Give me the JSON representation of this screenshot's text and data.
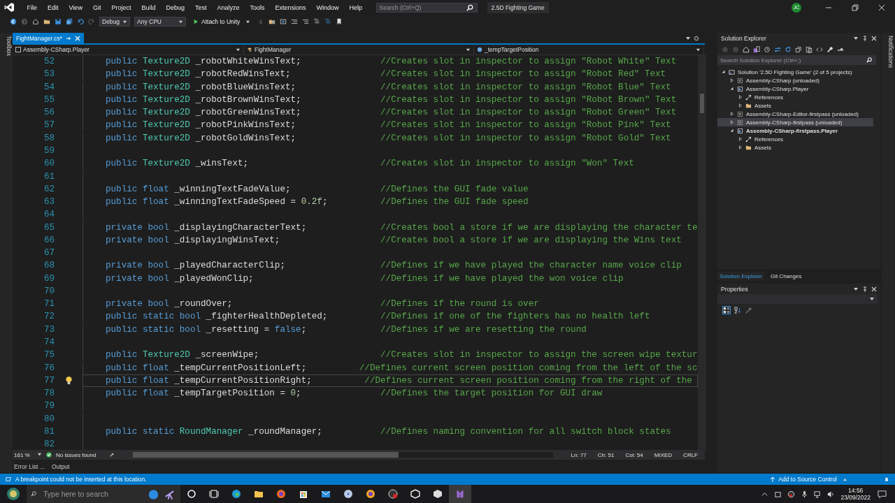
{
  "menu": [
    "File",
    "Edit",
    "View",
    "Git",
    "Project",
    "Build",
    "Debug",
    "Test",
    "Analyze",
    "Tools",
    "Extensions",
    "Window",
    "Help"
  ],
  "search": {
    "placeholder": "Search (Ctrl+Q)"
  },
  "solution_name": "2.5D Fighting Game",
  "avatar": "JC",
  "toolbar": {
    "configuration": "Debug",
    "platform": "Any CPU",
    "run_button": "Attach to Unity"
  },
  "side_strips": {
    "left": "Toolbox",
    "right": "Notifications"
  },
  "document_tabs": [
    {
      "label": "FightManager.cs*",
      "selected": true
    }
  ],
  "navigation_bar": [
    "Assembly-CSharp.Player",
    "FightManager",
    "_tempTargetPosition"
  ],
  "editor": {
    "lines": [
      {
        "number": "52",
        "current": false,
        "tokens": [
          {
            "kind": "keyword",
            "text": "public "
          },
          {
            "kind": "type",
            "text": "Texture2D"
          },
          {
            "kind": "plain",
            "text": " _robotWhiteWinsText;               "
          },
          {
            "kind": "comment",
            "text": "//Creates slot in inspector to assign \"Robot White\" Text"
          }
        ]
      },
      {
        "number": "53",
        "current": false,
        "tokens": [
          {
            "kind": "keyword",
            "text": "public "
          },
          {
            "kind": "type",
            "text": "Texture2D"
          },
          {
            "kind": "plain",
            "text": " _robotRedWinsText;                 "
          },
          {
            "kind": "comment",
            "text": "//Creates slot in inspector to assign \"Robot Red\" Text"
          }
        ]
      },
      {
        "number": "54",
        "current": false,
        "tokens": [
          {
            "kind": "keyword",
            "text": "public "
          },
          {
            "kind": "type",
            "text": "Texture2D"
          },
          {
            "kind": "plain",
            "text": " _robotBlueWinsText;                "
          },
          {
            "kind": "comment",
            "text": "//Creates slot in inspector to assign \"Robot Blue\" Text"
          }
        ]
      },
      {
        "number": "55",
        "current": false,
        "tokens": [
          {
            "kind": "keyword",
            "text": "public "
          },
          {
            "kind": "type",
            "text": "Texture2D"
          },
          {
            "kind": "plain",
            "text": " _robotBrownWinsText;               "
          },
          {
            "kind": "comment",
            "text": "//Creates slot in inspector to assign \"Robot Brown\" Text"
          }
        ]
      },
      {
        "number": "56",
        "current": false,
        "tokens": [
          {
            "kind": "keyword",
            "text": "public "
          },
          {
            "kind": "type",
            "text": "Texture2D"
          },
          {
            "kind": "plain",
            "text": " _robotGreenWinsText;               "
          },
          {
            "kind": "comment",
            "text": "//Creates slot in inspector to assign \"Robot Green\" Text"
          }
        ]
      },
      {
        "number": "57",
        "current": false,
        "tokens": [
          {
            "kind": "keyword",
            "text": "public "
          },
          {
            "kind": "type",
            "text": "Texture2D"
          },
          {
            "kind": "plain",
            "text": " _robotPinkWinsText;                "
          },
          {
            "kind": "comment",
            "text": "//Creates slot in inspector to assign \"Robot Pink\" Text"
          }
        ]
      },
      {
        "number": "58",
        "current": false,
        "tokens": [
          {
            "kind": "keyword",
            "text": "public "
          },
          {
            "kind": "type",
            "text": "Texture2D"
          },
          {
            "kind": "plain",
            "text": " _robotGoldWinsText;                "
          },
          {
            "kind": "comment",
            "text": "//Creates slot in inspector to assign \"Robot Gold\" Text"
          }
        ]
      },
      {
        "number": "59",
        "current": false
      },
      {
        "number": "60",
        "current": false,
        "tokens": [
          {
            "kind": "keyword",
            "text": "public "
          },
          {
            "kind": "type",
            "text": "Texture2D"
          },
          {
            "kind": "plain",
            "text": " _winsText;                         "
          },
          {
            "kind": "comment",
            "text": "//Creates slot in inspector to assign \"Won\" Text"
          }
        ]
      },
      {
        "number": "61",
        "current": false
      },
      {
        "number": "62",
        "current": false,
        "tokens": [
          {
            "kind": "keyword",
            "text": "public float"
          },
          {
            "kind": "plain",
            "text": " _winningTextFadeValue;                 "
          },
          {
            "kind": "comment",
            "text": "//Defines the GUI fade value"
          }
        ]
      },
      {
        "number": "63",
        "current": false,
        "tokens": [
          {
            "kind": "keyword",
            "text": "public float"
          },
          {
            "kind": "plain",
            "text": " _winningTextFadeSpeed = "
          },
          {
            "kind": "number",
            "text": "0.2f"
          },
          {
            "kind": "plain",
            "text": ";          "
          },
          {
            "kind": "comment",
            "text": "//Defines the GUI fade speed"
          }
        ]
      },
      {
        "number": "64",
        "current": false
      },
      {
        "number": "65",
        "current": false,
        "tokens": [
          {
            "kind": "keyword",
            "text": "private bool"
          },
          {
            "kind": "plain",
            "text": " _displayingCharacterText;              "
          },
          {
            "kind": "comment",
            "text": "//Creates bool a store if we are displaying the character te"
          }
        ]
      },
      {
        "number": "66",
        "current": false,
        "tokens": [
          {
            "kind": "keyword",
            "text": "private bool"
          },
          {
            "kind": "plain",
            "text": " _displayingWinsText;                   "
          },
          {
            "kind": "comment",
            "text": "//Creates bool a store if we are displaying the Wins text"
          }
        ]
      },
      {
        "number": "67",
        "current": false
      },
      {
        "number": "68",
        "current": false,
        "tokens": [
          {
            "kind": "keyword",
            "text": "private bool"
          },
          {
            "kind": "plain",
            "text": " _playedCharacterClip;                  "
          },
          {
            "kind": "comment",
            "text": "//Defines if we have played the character name voice clip"
          }
        ]
      },
      {
        "number": "69",
        "current": false,
        "tokens": [
          {
            "kind": "keyword",
            "text": "private bool"
          },
          {
            "kind": "plain",
            "text": " _playedWonClip;                        "
          },
          {
            "kind": "comment",
            "text": "//Defines if we have played the won voice clip"
          }
        ]
      },
      {
        "number": "70",
        "current": false
      },
      {
        "number": "71",
        "current": false,
        "tokens": [
          {
            "kind": "keyword",
            "text": "private bool"
          },
          {
            "kind": "plain",
            "text": " _roundOver;                            "
          },
          {
            "kind": "comment",
            "text": "//Defines if the round is over"
          }
        ]
      },
      {
        "number": "72",
        "current": false,
        "tokens": [
          {
            "kind": "keyword",
            "text": "public static bool"
          },
          {
            "kind": "plain",
            "text": " _fighterHealthDepleted;          "
          },
          {
            "kind": "comment",
            "text": "//Defines if one of the fighters has no health left"
          }
        ]
      },
      {
        "number": "73",
        "current": false,
        "tokens": [
          {
            "kind": "keyword",
            "text": "public static bool"
          },
          {
            "kind": "plain",
            "text": " _resetting = "
          },
          {
            "kind": "keyword",
            "text": "false"
          },
          {
            "kind": "plain",
            "text": ";              "
          },
          {
            "kind": "comment",
            "text": "//Defines if we are resetting the round"
          }
        ]
      },
      {
        "number": "74",
        "current": false
      },
      {
        "number": "75",
        "current": false,
        "tokens": [
          {
            "kind": "keyword",
            "text": "public "
          },
          {
            "kind": "type",
            "text": "Texture2D"
          },
          {
            "kind": "plain",
            "text": " _screenWipe;                       "
          },
          {
            "kind": "comment",
            "text": "//Creates slot in inspector to assign the screen wipe textur"
          }
        ]
      },
      {
        "number": "76",
        "current": false,
        "tokens": [
          {
            "kind": "keyword",
            "text": "public float"
          },
          {
            "kind": "plain",
            "text": " _tempCurrentPositionLeft;          "
          },
          {
            "kind": "comment",
            "text": "//Defines current screen position coming from the left of the sc"
          }
        ]
      },
      {
        "number": "77",
        "current": true,
        "tokens": [
          {
            "kind": "keyword",
            "text": "public float"
          },
          {
            "kind": "plain",
            "text": " _tempCurrentPositionRight;          "
          },
          {
            "kind": "comment",
            "text": "//Defines current screen position coming from the right of the"
          }
        ]
      },
      {
        "number": "78",
        "current": false,
        "tokens": [
          {
            "kind": "keyword",
            "text": "public float"
          },
          {
            "kind": "plain",
            "text": " _tempTargetPosition = "
          },
          {
            "kind": "number",
            "text": "0"
          },
          {
            "kind": "plain",
            "text": ";               "
          },
          {
            "kind": "comment",
            "text": "//Defines the target position for GUI draw"
          }
        ]
      },
      {
        "number": "79",
        "current": false
      },
      {
        "number": "80",
        "current": false
      },
      {
        "number": "81",
        "current": false,
        "tokens": [
          {
            "kind": "keyword",
            "text": "public static "
          },
          {
            "kind": "type",
            "text": "RoundManager"
          },
          {
            "kind": "plain",
            "text": " _roundManager;           "
          },
          {
            "kind": "comment",
            "text": "//Defines naming convention for all switch block states"
          }
        ]
      },
      {
        "number": "82",
        "current": false
      }
    ]
  },
  "editor_status": {
    "zoom": "161 %",
    "issues": "No issues found",
    "position": [
      "Ln: 77",
      "Ch: 51",
      "Col: 54",
      "MIXED",
      "CRLF"
    ]
  },
  "bottom_tabs": [
    {
      "label": "Error List ...",
      "selected": false
    },
    {
      "label": "Output",
      "selected": false
    }
  ],
  "status_bar": {
    "message": "A breakpoint could not be inserted at this location.",
    "source_control": "Add to Source Control"
  },
  "solution_explorer": {
    "title": "Solution Explorer",
    "search_placeholder": "Search Solution Explorer (Ctrl+;)",
    "items": [
      {
        "kind": "solution",
        "label": "Solution '2.5D Fighting Game' (2 of 5 projects)",
        "expanded": true,
        "selected": false,
        "bold": false,
        "children": [
          {
            "kind": "unloaded",
            "label": "Assembly-CSharp (unloaded)",
            "expanded": false,
            "selected": false,
            "bold": false
          },
          {
            "kind": "project",
            "label": "Assembly-CSharp.Player",
            "expanded": true,
            "selected": false,
            "bold": false,
            "children": [
              {
                "kind": "references",
                "label": "References",
                "expanded": false,
                "selected": false,
                "bold": false
              },
              {
                "kind": "folder",
                "label": "Assets",
                "expanded": false,
                "selected": false,
                "bold": false
              }
            ]
          },
          {
            "kind": "unloaded",
            "label": "Assembly-CSharp-Editor-firstpass (unloaded)",
            "expanded": false,
            "selected": false,
            "bold": false
          },
          {
            "kind": "unloaded",
            "label": "Assembly-CSharp-firstpass (unloaded)",
            "expanded": false,
            "selected": true,
            "bold": false
          },
          {
            "kind": "project",
            "label": "Assembly-CSharp-firstpass.Player",
            "expanded": true,
            "selected": false,
            "bold": true,
            "children": [
              {
                "kind": "references",
                "label": "References",
                "expanded": false,
                "selected": false,
                "bold": false
              },
              {
                "kind": "folder",
                "label": "Assets",
                "expanded": false,
                "selected": false,
                "bold": false
              }
            ]
          }
        ]
      }
    ]
  },
  "panel_tabs": [
    {
      "label": "Solution Explorer",
      "selected": true
    },
    {
      "label": "Git Changes",
      "selected": false
    }
  ],
  "properties": {
    "title": "Properties"
  },
  "taskbar": {
    "search_placeholder": "Type here to search",
    "time": "14:56",
    "date": "23/09/2022"
  }
}
